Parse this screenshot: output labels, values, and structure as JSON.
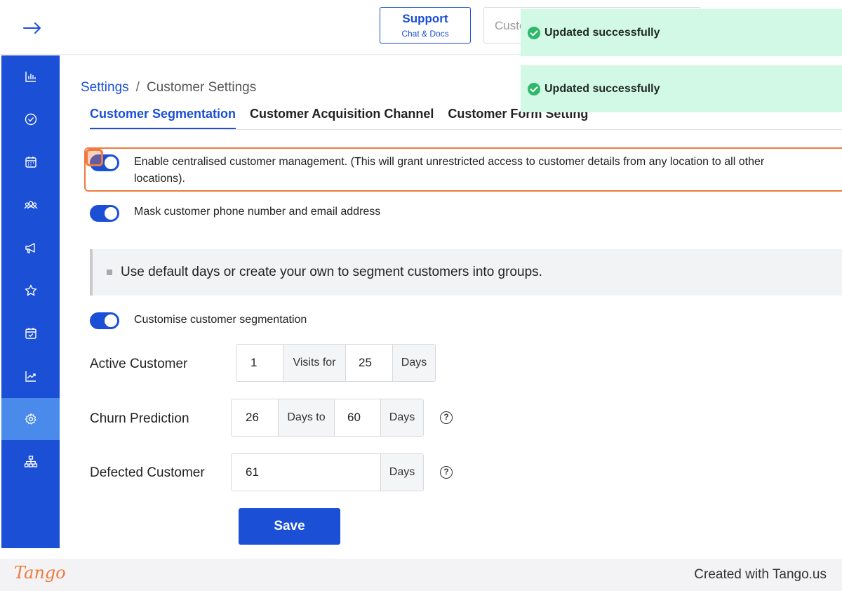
{
  "header": {
    "support_label": "Support",
    "support_sub": "Chat & Docs",
    "search_placeholder": "Custo"
  },
  "toasts": [
    {
      "message": "Updated successfully"
    },
    {
      "message": "Updated successfully"
    }
  ],
  "sidebar": {
    "items": [
      {
        "icon": "bar-chart-icon"
      },
      {
        "icon": "check-circle-icon"
      },
      {
        "icon": "calendar-icon"
      },
      {
        "icon": "users-icon"
      },
      {
        "icon": "megaphone-icon"
      },
      {
        "icon": "star-icon"
      },
      {
        "icon": "calendar-check-icon"
      },
      {
        "icon": "trend-chart-icon"
      },
      {
        "icon": "gear-icon",
        "active": true
      },
      {
        "icon": "org-chart-icon"
      }
    ]
  },
  "breadcrumb": {
    "parent": "Settings",
    "separator": "/",
    "current": "Customer Settings"
  },
  "tabs": [
    {
      "label": "Customer Segmentation",
      "active": true
    },
    {
      "label": "Customer Acquisition Channel"
    },
    {
      "label": "Customer Form Setting"
    }
  ],
  "options": {
    "centralised_line1": "Enable centralised customer management. (This will grant unrestricted access to customer details from any location to all other",
    "centralised_line2": "locations).",
    "mask": "Mask customer phone number and email address",
    "customise": "Customise customer segmentation"
  },
  "info": "Use default days or create your own to segment customers into groups.",
  "segments": {
    "active": {
      "label": "Active Customer",
      "visits": "1",
      "visits_label": "Visits for",
      "days": "25",
      "days_label": "Days"
    },
    "churn": {
      "label": "Churn Prediction",
      "from": "26",
      "to_label": "Days to",
      "to": "60",
      "days_label": "Days"
    },
    "defected": {
      "label": "Defected Customer",
      "days": "61",
      "days_label": "Days"
    }
  },
  "save_label": "Save",
  "footer": {
    "logo": "Tango",
    "credit": "Created with Tango.us"
  },
  "colors": {
    "primary": "#1a4fd6",
    "sidebar_active": "#4a8aeb",
    "highlight": "#f07a3d",
    "toast_bg": "#d2f8e6",
    "toast_check": "#2fb86b"
  }
}
